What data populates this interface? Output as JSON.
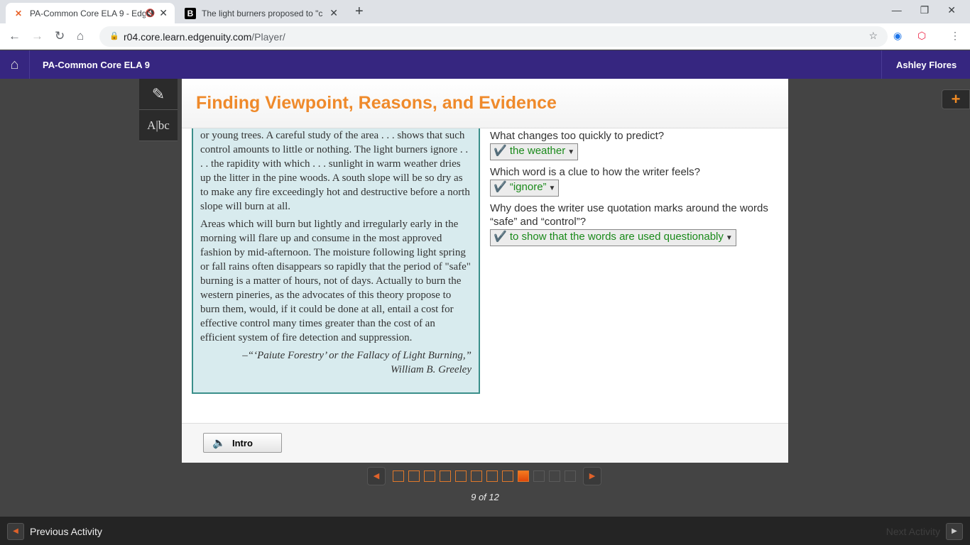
{
  "browser": {
    "tabs": [
      {
        "title": "PA-Common Core ELA 9 - Edgenuity",
        "icon": "edgenuity-logo-icon"
      },
      {
        "title": "The light burners proposed to \"c",
        "icon": "brainly-icon"
      }
    ],
    "url_host": "r04.core.learn.edgenuity.com",
    "url_path": "/Player/"
  },
  "header": {
    "course": "PA-Common Core ELA 9",
    "user": "Ashley Flores"
  },
  "lesson": {
    "title": "Finding Viewpoint, Reasons, and Evidence"
  },
  "passage": {
    "paragraphs": [
      "or young trees. A careful study of the area . . . shows that such control amounts to little or nothing. The light burners ignore . . . . the rapidity with which . . . sunlight in warm weather dries up the litter in the pine woods. A south slope will be so dry as to make any fire exceedingly hot and destructive before a north slope will burn at all.",
      "Areas which will burn but lightly and irregularly early in the morning will flare up and consume in the most approved fashion by mid-afternoon. The moisture following light spring or fall rains often disappears so rapidly that the period of \"safe\" burning is a matter of hours, not of days. Actually to burn the western pineries, as the advocates of this theory propose to burn them, would, if it could be done at all, entail a cost for effective control many times greater than the cost of an efficient system of fire detection and suppression."
    ],
    "citation_1": "–“‘Paiute Forestry’ or the Fallacy of Light Burning,”",
    "citation_2": "William B. Greeley"
  },
  "questions": [
    {
      "text": "What changes too quickly to predict?",
      "answer": "✔️ the weather"
    },
    {
      "text": "Which word is a clue to how the writer feels?",
      "answer": "✔️ “ignore”"
    },
    {
      "text": "Why does the writer use quotation marks around the words “safe” and “control”?",
      "answer": "✔️ to show that the words are used questionably"
    }
  ],
  "footer": {
    "intro_label": "Intro"
  },
  "pager": {
    "current": 9,
    "total": 12,
    "label": "9 of 12"
  },
  "bottom": {
    "prev_label": "Previous Activity",
    "next_label": "Next Activity"
  },
  "colors": {
    "accent": "#ef8a2b",
    "topbar": "#362680",
    "correct": "#1a8a1a"
  }
}
